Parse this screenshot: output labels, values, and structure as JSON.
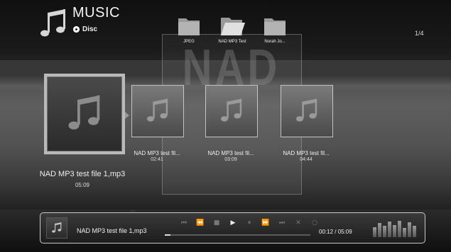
{
  "header": {
    "title": "MUSIC",
    "source_label": "Disc",
    "page_indicator": "1/4"
  },
  "folders": [
    {
      "label": "JPEG",
      "open": false
    },
    {
      "label": "NAD MP3 Test",
      "open": true
    },
    {
      "label": "Norah Jo...",
      "open": false
    }
  ],
  "watermark": "NAD",
  "tracks": [
    {
      "name": "NAD MP3 test file 1,mp3",
      "duration": "05:09",
      "selected": true
    },
    {
      "name": "NAD MP3 test fil...",
      "duration": "02:41",
      "selected": false
    },
    {
      "name": "NAD MP3 test fil...",
      "duration": "03:09",
      "selected": false
    },
    {
      "name": "NAD MP3 test fil...",
      "duration": "04:44",
      "selected": false
    }
  ],
  "player": {
    "now_playing": "NAD MP3 test file 1,mp3",
    "elapsed": "00:12",
    "total": "05:09",
    "time_display": "00:12 / 05:09",
    "progress_fraction": 0.04,
    "controls": [
      {
        "icon": "skip-back-icon",
        "glyph": "⏮",
        "active": false
      },
      {
        "icon": "rewind-icon",
        "glyph": "⏪",
        "active": false
      },
      {
        "icon": "stop-icon",
        "glyph": "■",
        "active": false
      },
      {
        "icon": "play-icon",
        "glyph": "▶",
        "active": true
      },
      {
        "icon": "pause-icon",
        "glyph": "⏸",
        "active": false
      },
      {
        "icon": "fast-forward-icon",
        "glyph": "⏩",
        "active": false
      },
      {
        "icon": "skip-forward-icon",
        "glyph": "⏭",
        "active": false
      },
      {
        "icon": "shuffle-icon",
        "glyph": "✕",
        "active": false
      },
      {
        "icon": "repeat-icon",
        "glyph": "○",
        "active": false
      }
    ],
    "spectrum_levels": [
      0.55,
      0.75,
      0.6,
      0.85,
      0.65,
      0.9,
      0.5,
      0.8,
      0.6
    ]
  },
  "colors": {
    "background": "#5e5e5e",
    "highlight_border": "#b9b9b9",
    "text": "#e8e8e8"
  }
}
